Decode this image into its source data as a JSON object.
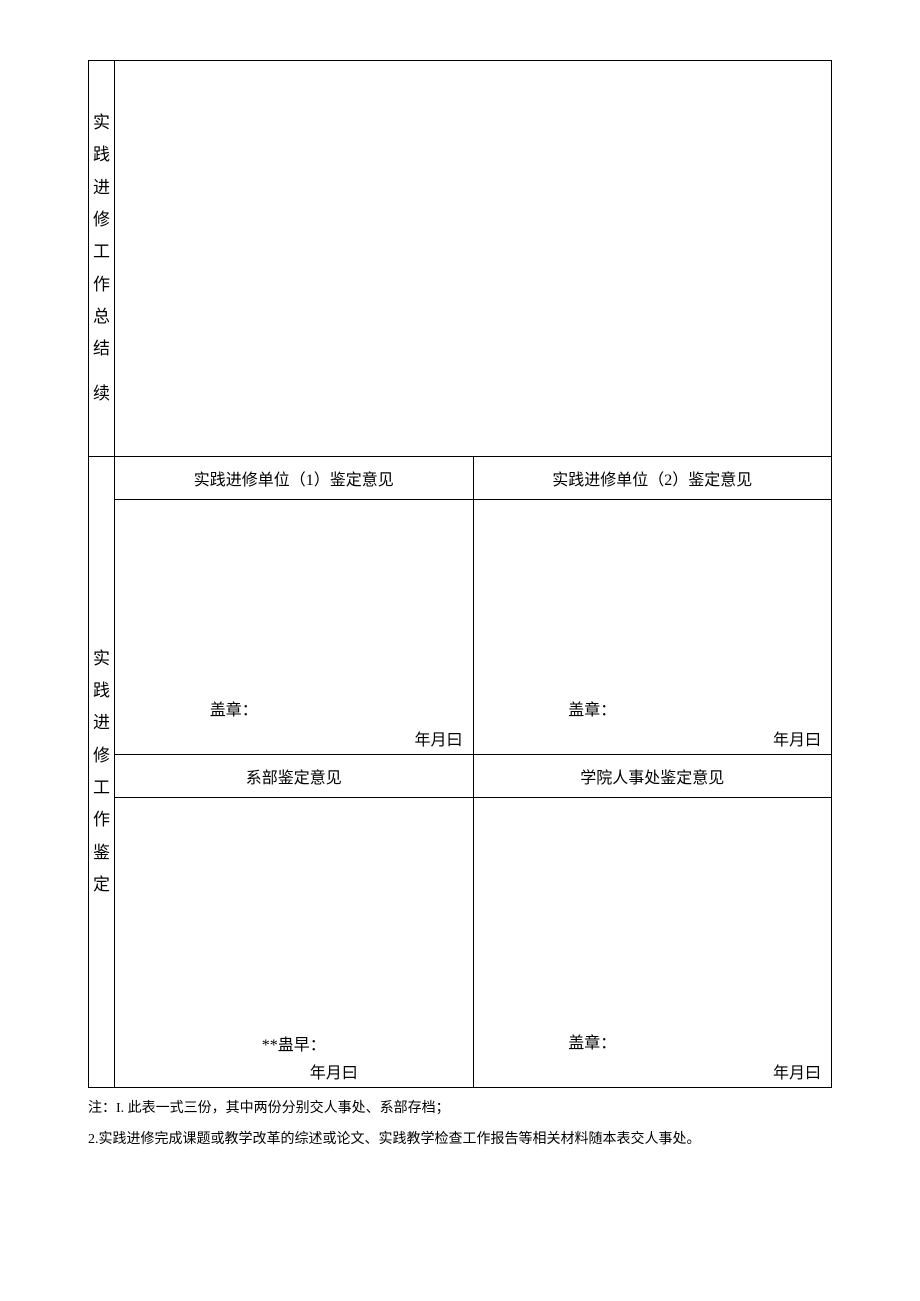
{
  "labels": {
    "summary_line1": "实践",
    "summary_line2": "进修",
    "summary_line3": "工作",
    "summary_line4": "总结",
    "summary_line5": "续",
    "appraisal_line1": "实践",
    "appraisal_line2": "进修",
    "appraisal_line3": "工作",
    "appraisal_line4": "鉴定"
  },
  "section2": {
    "header1": "实践进修单位（1）鉴定意见",
    "header2": "实践进修单位（2）鉴定意见",
    "stamp1": "盖章：",
    "date1": "年月曰",
    "stamp2": "盖章：",
    "date2": "年月曰",
    "header3": "系部鉴定意见",
    "header4": "学院人事处鉴定意见",
    "stamp3": "**蛊早：",
    "date3": "年月曰",
    "stamp4": "盖章：",
    "date4": "年月曰"
  },
  "notes": {
    "note1": "注：I. 此表一式三份，其中两份分别交人事处、系部存档；",
    "note2": "2.实践进修完成课题或教学改革的综述或论文、实践教学检查工作报告等相关材料随本表交人事处。"
  }
}
